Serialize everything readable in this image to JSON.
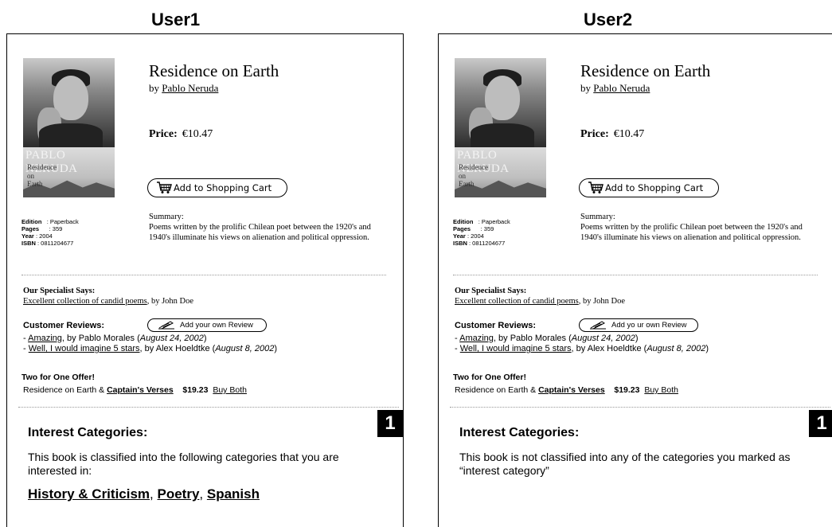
{
  "users": [
    {
      "label": "User1",
      "book": {
        "cover_author": "PABLO NERUDA",
        "cover_lines": [
          "Residence",
          "on",
          "Earth"
        ],
        "title": "Residence on Earth",
        "by": "by",
        "author": "Pablo Neruda",
        "price_label": "Price:",
        "price": "€10.47",
        "cart_label": "Add to Shopping Cart",
        "meta": [
          {
            "key": "Edition",
            "value": ": Paperback"
          },
          {
            "key": "Pages",
            "value": ": 359"
          },
          {
            "key": "Year",
            "value": ": 2004"
          },
          {
            "key": "ISBN",
            "value": ": 0811204677"
          }
        ],
        "summary_label": "Summary:",
        "summary": "Poems written by the prolific Chilean poet between the 1920's and 1940's illuminate his views on alienation and political oppression.",
        "specialist_label": "Our Specialist Says:",
        "specialist_link": "Excellent collection of candid poems",
        "specialist_by": ", by John Doe",
        "reviews_label": "Customer Reviews:",
        "add_review_label": "Add your own Review",
        "reviews": [
          {
            "prefix": "- ",
            "title": "Amazing",
            "by": ", by Pablo Morales (",
            "date": "August 24, 2002",
            "end": ")"
          },
          {
            "prefix": "- ",
            "title": "Well, I would imagine 5 stars",
            "by": ", by Alex Hoeldtke (",
            "date": "August 8, 2002",
            "end": ")"
          }
        ],
        "offer_label": "Two for One Offer!",
        "offer_text": "Residence on Earth & ",
        "offer_link": "Captain's Verses",
        "offer_price": "$19.23",
        "offer_buy": "Buy Both"
      },
      "badge": "1",
      "interest": {
        "title": "Interest Categories:",
        "description": "This book is classified into the following categories that you are interested in:",
        "categories": [
          "History & Criticism",
          "Poetry",
          "Spanish"
        ],
        "separator": ", "
      }
    },
    {
      "label": "User2",
      "book": {
        "cover_author": "PABLO NERUDA",
        "cover_lines": [
          "Residence",
          "on",
          "Earth"
        ],
        "title": "Residence on Earth",
        "by": "by",
        "author": "Pablo Neruda",
        "price_label": "Price:",
        "price": "€10.47",
        "cart_label": "Add to Shopping Cart",
        "meta": [
          {
            "key": "Edition",
            "value": ": Paperback"
          },
          {
            "key": "Pages",
            "value": ": 359"
          },
          {
            "key": "Year",
            "value": ": 2004"
          },
          {
            "key": "ISBN",
            "value": ": 0811204677"
          }
        ],
        "summary_label": "Summary:",
        "summary": "Poems written by the prolific Chilean poet between the 1920's and 1940's illuminate his views on alienation and political oppression.",
        "specialist_label": "Our Specialist Says:",
        "specialist_link": "Excellent collection of candid poems",
        "specialist_by": ", by John Doe",
        "reviews_label": "Customer Reviews:",
        "add_review_label": "Add yo ur own Review",
        "reviews": [
          {
            "prefix": "- ",
            "title": "Amazing",
            "by": ", by Pablo Morales (",
            "date": "August 24, 2002",
            "end": ")"
          },
          {
            "prefix": "- ",
            "title": "Well, I would imagine 5 stars",
            "by": ", by Alex Hoeldtke (",
            "date": "August 8, 2002",
            "end": ")"
          }
        ],
        "offer_label": "Two for One Offer!",
        "offer_text": "Residence on Earth & ",
        "offer_link": "Captain's Verses",
        "offer_price": "$19.23",
        "offer_buy": "Buy Both"
      },
      "badge": "1",
      "interest": {
        "title": "Interest Categories:",
        "description": "This book is not classified into any of the categories you marked as “interest category”",
        "categories": [],
        "separator": ", "
      }
    }
  ]
}
